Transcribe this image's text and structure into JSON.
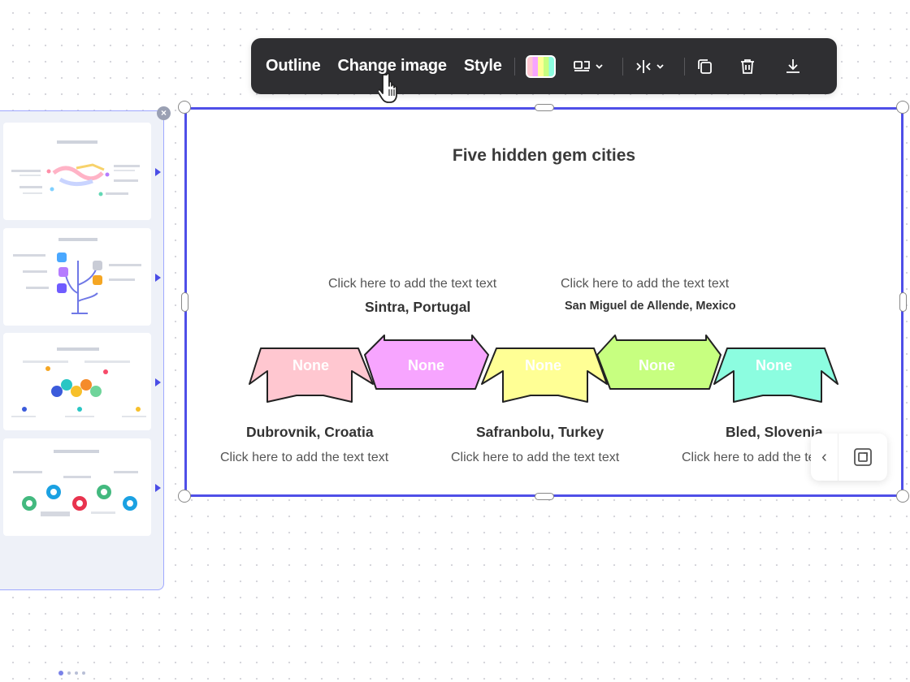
{
  "toolbar": {
    "outline_label": "Outline",
    "change_image_label": "Change image",
    "style_label": "Style",
    "icons": [
      "color-swatch-icon",
      "layout-icon",
      "mirror-icon",
      "duplicate-icon",
      "trash-icon",
      "download-icon"
    ]
  },
  "left_panel": {
    "close_icon": "×",
    "thumbnails": [
      "handshake-layout",
      "tree-layout",
      "hexagon-layout",
      "circles-layout"
    ]
  },
  "slide": {
    "title": "Five hidden gem cities",
    "items": [
      {
        "city": "Dubrovnik, Croatia",
        "hint": "Click here to add the text text",
        "shape_label": "None",
        "color": "#ffc7d0"
      },
      {
        "city": "Sintra, Portugal",
        "hint": "Click here to add the text text",
        "shape_label": "None",
        "color": "#f7a5ff"
      },
      {
        "city": "Safranbolu, Turkey",
        "hint": "Click here to add the text text",
        "shape_label": "None",
        "color": "#ffff95"
      },
      {
        "city": "San Miguel de Allende, Mexico",
        "hint": "Click here to add the text text",
        "shape_label": "None",
        "color": "#c7ff80"
      },
      {
        "city": "Bled, Slovenia",
        "hint": "Click here to add the text text",
        "shape_label": "None",
        "color": "#8cfde0"
      }
    ],
    "selection_color": "#4f4fe8"
  },
  "float_widget": {
    "back_icon": "‹"
  }
}
